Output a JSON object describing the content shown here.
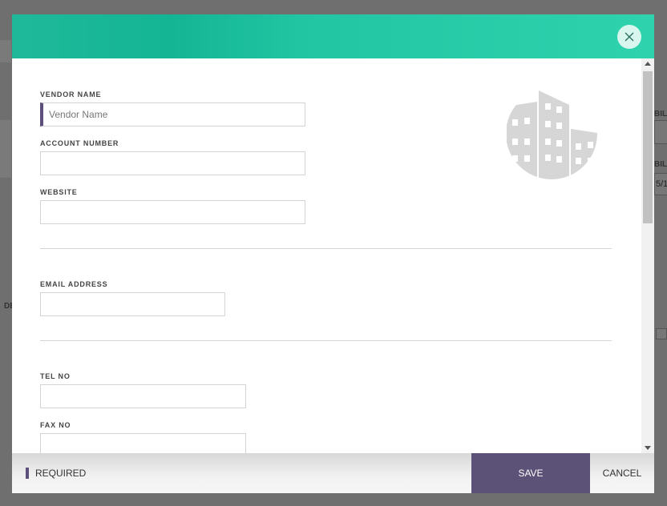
{
  "background": {
    "fragment_bill_1": "BILL",
    "fragment_bill_2": "BILL",
    "fragment_date": "5/1",
    "fragment_de": "DE"
  },
  "form": {
    "vendor_name": {
      "label": "VENDOR NAME",
      "value": "",
      "placeholder": "Vendor Name",
      "required": true
    },
    "account_number": {
      "label": "ACCOUNT NUMBER",
      "value": ""
    },
    "website": {
      "label": "WEBSITE",
      "value": ""
    },
    "email_address": {
      "label": "EMAIL ADDRESS",
      "value": ""
    },
    "tel_no": {
      "label": "TEL NO",
      "value": ""
    },
    "fax_no": {
      "label": "FAX NO",
      "value": ""
    }
  },
  "icons": {
    "close": "close-icon",
    "vendor": "building-icon"
  },
  "footer": {
    "required_label": "REQUIRED",
    "save_label": "SAVE",
    "cancel_label": "CANCEL"
  },
  "colors": {
    "header_start": "#13b595",
    "header_end": "#2ed3ad",
    "accent": "#5c4f7a",
    "save_button": "#5c5277"
  }
}
